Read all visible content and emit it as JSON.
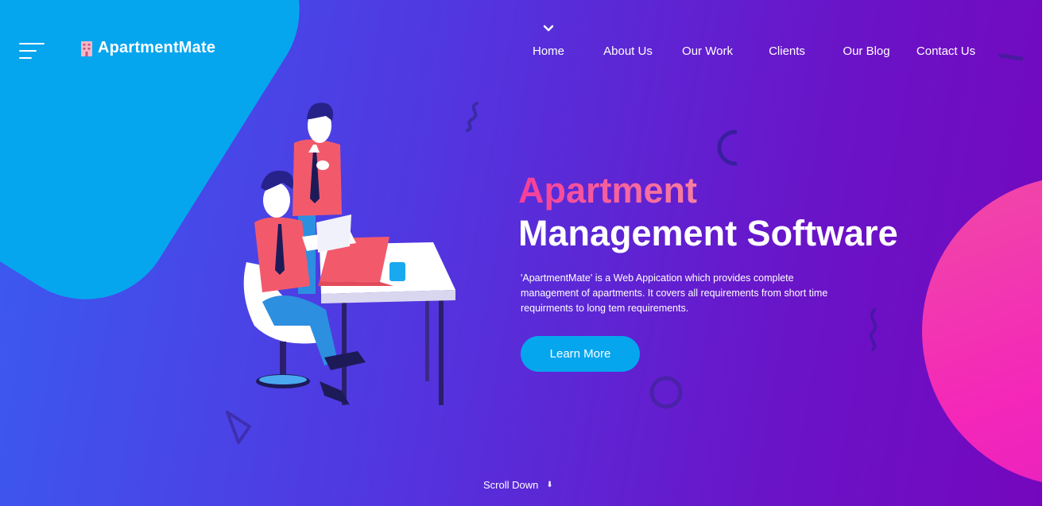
{
  "brand": {
    "name": "ApartmentMate",
    "icon": "building-icon"
  },
  "nav": {
    "items": [
      {
        "label": "Home",
        "active": true
      },
      {
        "label": "About Us"
      },
      {
        "label": "Our Work"
      },
      {
        "label": "Clients"
      },
      {
        "label": "Our Blog"
      },
      {
        "label": "Contact Us"
      }
    ],
    "active_indicator_icon": "chevron-down-icon"
  },
  "hero": {
    "headline_line1": "Apartment",
    "headline_line2": "Management Software",
    "description": "'ApartmentMate' is a Web Appication which provides complete management of apartments. It covers all requirements from short time requirments to long tem requirements.",
    "cta_label": "Learn More",
    "scroll_label": "Scroll Down",
    "scroll_icon": "arrow-down-icon"
  },
  "colors": {
    "bg_start": "#3a5cf0",
    "bg_end": "#7407bd",
    "accent_blue": "#06a6ef",
    "accent_pink": "#f427b9",
    "headline_pink": "#f53d9a"
  }
}
